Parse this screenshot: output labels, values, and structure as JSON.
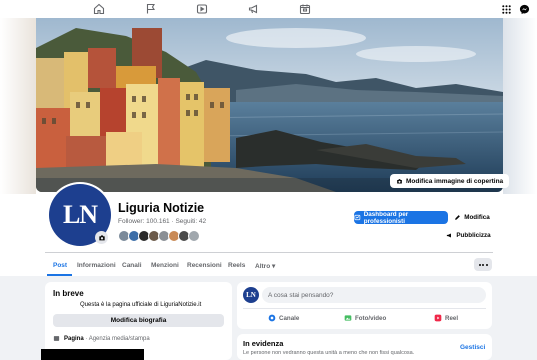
{
  "nav": {
    "icons": [
      "home-icon",
      "flag-icon",
      "video-icon",
      "megaphone-icon",
      "marketplace-icon"
    ],
    "right_icons": [
      "apps-grid-icon",
      "messenger-icon"
    ]
  },
  "cover": {
    "edit_label": "Modifica immagine di copertina"
  },
  "profile": {
    "name": "Liguria Notizie",
    "avatar_initials": "LN",
    "followers_text": "Follower: 100.161 · Seguiti: 42"
  },
  "actions": {
    "dashboard_label": "Dashboard per professionisti",
    "edit_label": "Modifica",
    "promote_label": "Pubblicizza"
  },
  "tabs": [
    {
      "label": "Post",
      "active": true
    },
    {
      "label": "Informazioni",
      "active": false
    },
    {
      "label": "Canali",
      "active": false
    },
    {
      "label": "Menzioni",
      "active": false
    },
    {
      "label": "Recensioni",
      "active": false
    },
    {
      "label": "Reels",
      "active": false
    },
    {
      "label": "Altro ▾",
      "active": false
    }
  ],
  "intro": {
    "title": "In breve",
    "description": "Questa è la pagina ufficiale di LiguriaNotizie.it",
    "edit_bio_label": "Modifica biografia",
    "page_label": "Pagina",
    "page_category": " · Agenzia media/stampa"
  },
  "composer": {
    "avatar_initials": "LN",
    "placeholder": "A cosa stai pensando?",
    "channel_label": "Canale",
    "photo_label": "Foto/video",
    "reel_label": "Reel"
  },
  "featured": {
    "title": "In evidenza",
    "manage_label": "Gestisci",
    "note": "Le persone non vedranno questa unità a meno che non fissi qualcosa."
  },
  "colors": {
    "accent": "#1b74e4",
    "avatar_bg": "#1d3f8f"
  }
}
